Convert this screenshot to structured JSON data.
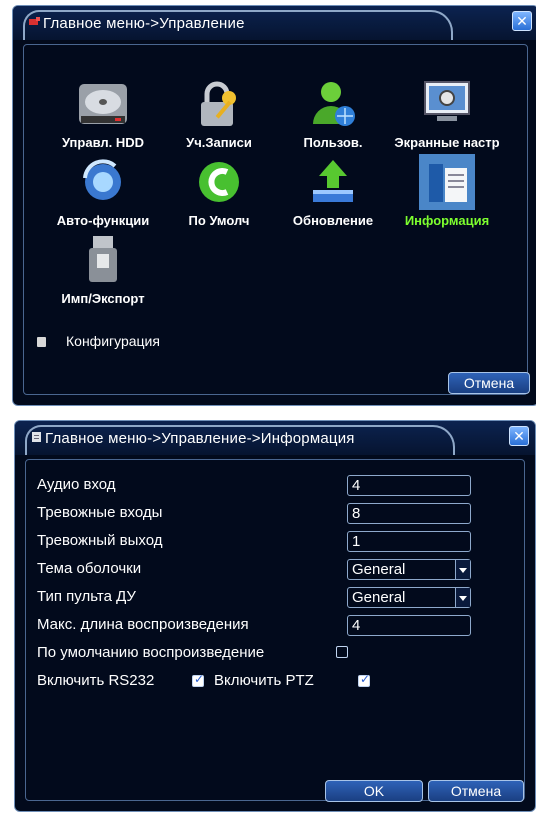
{
  "window1": {
    "title": "Главное меню->Управление",
    "close_label": "✕",
    "tiles": [
      {
        "label": "Управл. HDD",
        "icon": "hdd-icon"
      },
      {
        "label": "Уч.Записи",
        "icon": "lock-icon"
      },
      {
        "label": "Пользов.",
        "icon": "user-icon"
      },
      {
        "label": "Экранные настр",
        "icon": "display-settings-icon"
      },
      {
        "label": "Авто-функции",
        "icon": "auto-function-icon"
      },
      {
        "label": "По Умолч",
        "icon": "default-reset-icon"
      },
      {
        "label": "Обновление",
        "icon": "upgrade-icon"
      },
      {
        "label": "Информация",
        "icon": "info-icon"
      },
      {
        "label": "Имп/Экспорт",
        "icon": "usb-import-export-icon"
      }
    ],
    "active_tile": "Информация",
    "config_label": "Конфигурация",
    "cancel_label": "Отмена"
  },
  "window2": {
    "title": "Главное меню->Управление->Информация",
    "close_label": "✕",
    "fields": {
      "audio_in": {
        "label": "Аудио вход",
        "value": "4"
      },
      "alarm_in": {
        "label": "Тревожные входы",
        "value": "8"
      },
      "alarm_out": {
        "label": "Тревожный выход",
        "value": "1"
      },
      "skin": {
        "label": "Тема оболочки",
        "value": "General"
      },
      "remote": {
        "label": "Тип пульта ДУ",
        "value": "General"
      },
      "play_len": {
        "label": "Макс. длина воспроизведения",
        "value": "4"
      },
      "default_play": {
        "label": "По умолчанию воспроизведение",
        "checked": false
      },
      "rs232": {
        "label": "Включить RS232",
        "checked": true
      },
      "ptz": {
        "label": "Включить PTZ",
        "checked": true
      }
    },
    "ok_label": "OK",
    "cancel_label": "Отмена"
  },
  "colors": {
    "background": "#020a1c",
    "border": "#6f8fb8",
    "active_label": "#7dff2e",
    "button": "#1a3f82"
  }
}
